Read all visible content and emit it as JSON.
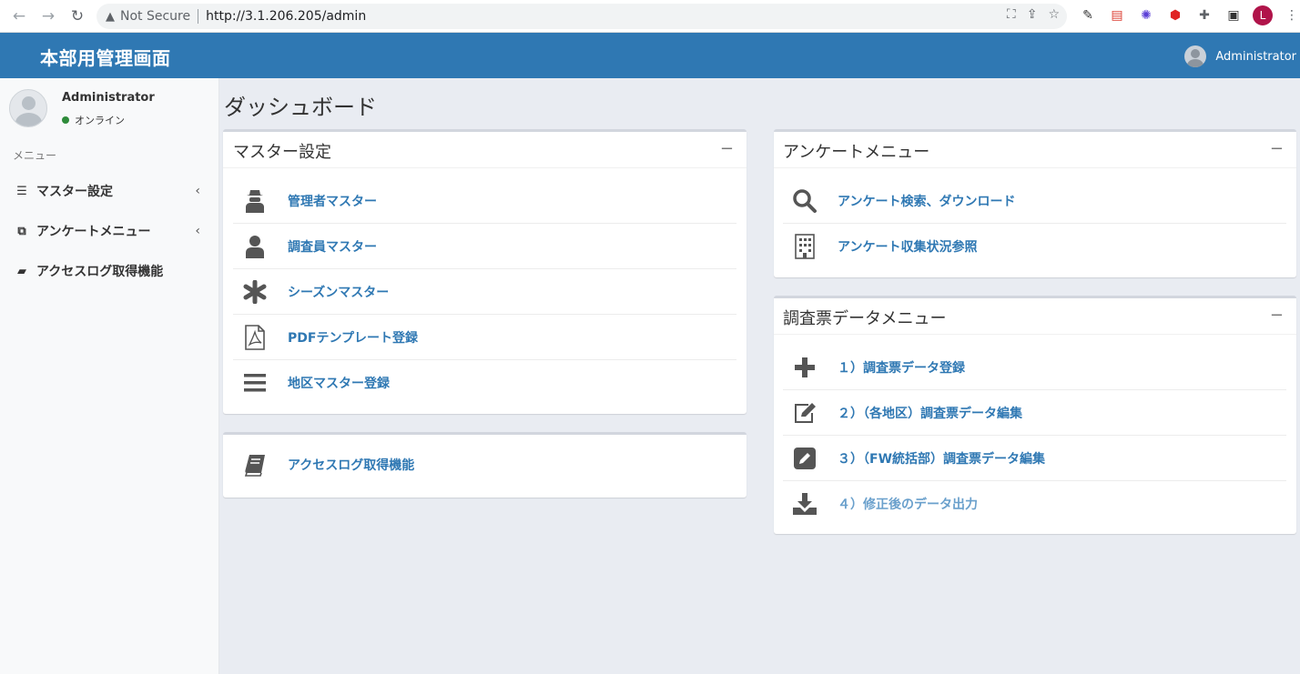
{
  "browser": {
    "security_label": "Not Secure",
    "url": "http://3.1.206.205/admin",
    "profile_initial": "L"
  },
  "header": {
    "brand": "本部用管理画面",
    "user_name": "Administrator"
  },
  "sidebar": {
    "user_name": "Administrator",
    "status": "オンライン",
    "menu_header": "メニュー",
    "items": [
      {
        "label": "マスター設定"
      },
      {
        "label": "アンケートメニュー"
      },
      {
        "label": "アクセスログ取得機能"
      }
    ]
  },
  "page": {
    "title": "ダッシュボード"
  },
  "master_box": {
    "title": "マスター設定",
    "collapse_symbol": "−",
    "items": [
      {
        "label": "管理者マスター",
        "icon": "user-secret-icon"
      },
      {
        "label": "調査員マスター",
        "icon": "user-icon"
      },
      {
        "label": "シーズンマスター",
        "icon": "asterisk-icon"
      },
      {
        "label": "PDFテンプレート登録",
        "icon": "pdf-file-icon"
      },
      {
        "label": "地区マスター登録",
        "icon": "bars-icon"
      }
    ]
  },
  "access_box": {
    "items": [
      {
        "label": "アクセスログ取得機能",
        "icon": "book-icon"
      }
    ]
  },
  "survey_box": {
    "title": "アンケートメニュー",
    "collapse_symbol": "−",
    "items": [
      {
        "label": "アンケート検索、ダウンロード",
        "icon": "search-icon"
      },
      {
        "label": "アンケート収集状況参照",
        "icon": "building-icon"
      }
    ]
  },
  "form_box": {
    "title": "調査票データメニュー",
    "collapse_symbol": "−",
    "items": [
      {
        "label": "１）調査票データ登録",
        "icon": "plus-icon"
      },
      {
        "label": "２）（各地区）調査票データ編集",
        "icon": "edit-icon"
      },
      {
        "label": "３）（FW統括部）調査票データ編集",
        "icon": "pencil-square-icon"
      },
      {
        "label": "４）修正後のデータ出力",
        "icon": "download-icon"
      }
    ]
  },
  "colors": {
    "header_bg": "#2f78b3",
    "link": "#2f78b3",
    "online": "#2e8b3a"
  }
}
